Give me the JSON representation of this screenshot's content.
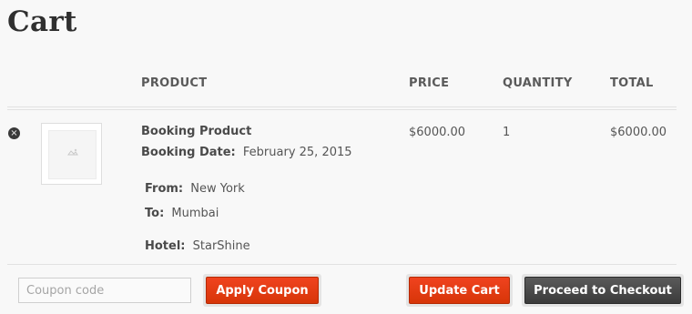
{
  "page": {
    "title": "Cart"
  },
  "table": {
    "headers": {
      "product": "PRODUCT",
      "price": "PRICE",
      "quantity": "QUANTITY",
      "total": "TOTAL"
    }
  },
  "item": {
    "remove_symbol": "×",
    "name": "Booking Product",
    "booking_date_label": "Booking Date:",
    "booking_date": "February 25, 2015",
    "from_label": "From:",
    "from": "New York",
    "to_label": "To:",
    "to": "Mumbai",
    "hotel_label": "Hotel:",
    "hotel": "StarShine",
    "price": "$6000.00",
    "quantity": "1",
    "total": "$6000.00",
    "thumbnail_icon": "image-placeholder-icon"
  },
  "actions": {
    "coupon_placeholder": "Coupon code",
    "coupon_value": "",
    "apply_coupon": "Apply Coupon",
    "update_cart": "Update Cart",
    "proceed_to_checkout": "Proceed to Checkout"
  },
  "colors": {
    "accent": "#e03c10",
    "dark_button": "#474747",
    "background": "#f8f8f8"
  }
}
